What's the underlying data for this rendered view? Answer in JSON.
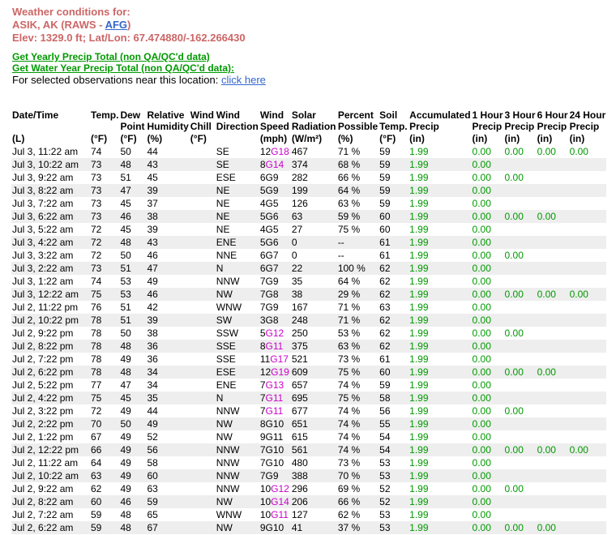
{
  "header": {
    "line1": "Weather conditions for:",
    "station_prefix": "ASIK, AK (RAWS - ",
    "station_link": "AFG",
    "station_suffix": ")",
    "elev": "Elev: 1329.0 ft; Lat/Lon: 67.474880/-162.266430"
  },
  "links": {
    "yearly": "Get Yearly Precip Total (non QA/QC'd data)",
    "water_year": "Get Water Year Precip Total (non QA/QC'd data):",
    "selected_text": "For selected observations near this location: ",
    "click_here": "click here"
  },
  "table": {
    "columns": [
      {
        "l1": "Date/Time",
        "l2": "",
        "l3": "(L)"
      },
      {
        "l1": "Temp.",
        "l2": "",
        "l3": "(°F)"
      },
      {
        "l1": "Dew",
        "l2": "Point",
        "l3": "(°F)"
      },
      {
        "l1": "Relative",
        "l2": "Humidity",
        "l3": "(%)"
      },
      {
        "l1": "Wind",
        "l2": "Chill",
        "l3": "(°F)"
      },
      {
        "l1": "Wind",
        "l2": "Direction",
        "l3": ""
      },
      {
        "l1": "Wind",
        "l2": "Speed",
        "l3": "(mph)"
      },
      {
        "l1": "Solar",
        "l2": "Radiation",
        "l3": "(W/m²)"
      },
      {
        "l1": "Percent",
        "l2": "Possible",
        "l3": "(%)"
      },
      {
        "l1": "Soil",
        "l2": "Temp.",
        "l3": "(°F)"
      },
      {
        "l1": "Accumulated",
        "l2": "Precip",
        "l3": "(in)"
      },
      {
        "l1": "1 Hour",
        "l2": "Precip",
        "l3": "(in)"
      },
      {
        "l1": "3 Hour",
        "l2": "Precip",
        "l3": "(in)"
      },
      {
        "l1": "6 Hour",
        "l2": "Precip",
        "l3": "(in)"
      },
      {
        "l1": "24 Hour",
        "l2": "Precip",
        "l3": "(in)"
      }
    ],
    "rows": [
      {
        "dt": "Jul 3, 11:22 am",
        "t": "74",
        "dp": "50",
        "rh": "44",
        "wc": "",
        "dir": "SE",
        "ws": "12",
        "wg": "G18",
        "sr": "467",
        "pp": "71 %",
        "st": "59",
        "acc": "1.99",
        "h1": "0.00",
        "h3": "0.00",
        "h6": "0.00",
        "h24": "0.00"
      },
      {
        "dt": "Jul 3, 10:22 am",
        "t": "73",
        "dp": "48",
        "rh": "43",
        "wc": "",
        "dir": "SE",
        "ws": "8",
        "wg": "G14",
        "sr": "374",
        "pp": "68 %",
        "st": "59",
        "acc": "1.99",
        "h1": "0.00",
        "h3": "",
        "h6": "",
        "h24": ""
      },
      {
        "dt": "Jul 3, 9:22 am",
        "t": "73",
        "dp": "51",
        "rh": "45",
        "wc": "",
        "dir": "ESE",
        "ws": "6G9",
        "wg": "",
        "sr": "282",
        "pp": "66 %",
        "st": "59",
        "acc": "1.99",
        "h1": "0.00",
        "h3": "0.00",
        "h6": "",
        "h24": ""
      },
      {
        "dt": "Jul 3, 8:22 am",
        "t": "73",
        "dp": "47",
        "rh": "39",
        "wc": "",
        "dir": "NE",
        "ws": "5G9",
        "wg": "",
        "sr": "199",
        "pp": "64 %",
        "st": "59",
        "acc": "1.99",
        "h1": "0.00",
        "h3": "",
        "h6": "",
        "h24": ""
      },
      {
        "dt": "Jul 3, 7:22 am",
        "t": "73",
        "dp": "45",
        "rh": "37",
        "wc": "",
        "dir": "NE",
        "ws": "4G5",
        "wg": "",
        "sr": "126",
        "pp": "63 %",
        "st": "59",
        "acc": "1.99",
        "h1": "0.00",
        "h3": "",
        "h6": "",
        "h24": ""
      },
      {
        "dt": "Jul 3, 6:22 am",
        "t": "73",
        "dp": "46",
        "rh": "38",
        "wc": "",
        "dir": "NE",
        "ws": "5G6",
        "wg": "",
        "sr": "63",
        "pp": "59 %",
        "st": "60",
        "acc": "1.99",
        "h1": "0.00",
        "h3": "0.00",
        "h6": "0.00",
        "h24": ""
      },
      {
        "dt": "Jul 3, 5:22 am",
        "t": "72",
        "dp": "45",
        "rh": "39",
        "wc": "",
        "dir": "NE",
        "ws": "4G5",
        "wg": "",
        "sr": "27",
        "pp": "75 %",
        "st": "60",
        "acc": "1.99",
        "h1": "0.00",
        "h3": "",
        "h6": "",
        "h24": ""
      },
      {
        "dt": "Jul 3, 4:22 am",
        "t": "72",
        "dp": "48",
        "rh": "43",
        "wc": "",
        "dir": "ENE",
        "ws": "5G6",
        "wg": "",
        "sr": "0",
        "pp": "--",
        "st": "61",
        "acc": "1.99",
        "h1": "0.00",
        "h3": "",
        "h6": "",
        "h24": ""
      },
      {
        "dt": "Jul 3, 3:22 am",
        "t": "72",
        "dp": "50",
        "rh": "46",
        "wc": "",
        "dir": "NNE",
        "ws": "6G7",
        "wg": "",
        "sr": "0",
        "pp": "--",
        "st": "61",
        "acc": "1.99",
        "h1": "0.00",
        "h3": "0.00",
        "h6": "",
        "h24": ""
      },
      {
        "dt": "Jul 3, 2:22 am",
        "t": "73",
        "dp": "51",
        "rh": "47",
        "wc": "",
        "dir": "N",
        "ws": "6G7",
        "wg": "",
        "sr": "22",
        "pp": "100 %",
        "st": "62",
        "acc": "1.99",
        "h1": "0.00",
        "h3": "",
        "h6": "",
        "h24": ""
      },
      {
        "dt": "Jul 3, 1:22 am",
        "t": "74",
        "dp": "53",
        "rh": "49",
        "wc": "",
        "dir": "NNW",
        "ws": "7G9",
        "wg": "",
        "sr": "35",
        "pp": "64 %",
        "st": "62",
        "acc": "1.99",
        "h1": "0.00",
        "h3": "",
        "h6": "",
        "h24": ""
      },
      {
        "dt": "Jul 3, 12:22 am",
        "t": "75",
        "dp": "53",
        "rh": "46",
        "wc": "",
        "dir": "NW",
        "ws": "7G8",
        "wg": "",
        "sr": "38",
        "pp": "29 %",
        "st": "62",
        "acc": "1.99",
        "h1": "0.00",
        "h3": "0.00",
        "h6": "0.00",
        "h24": "0.00"
      },
      {
        "dt": "Jul 2, 11:22 pm",
        "t": "76",
        "dp": "51",
        "rh": "42",
        "wc": "",
        "dir": "WNW",
        "ws": "7G9",
        "wg": "",
        "sr": "167",
        "pp": "71 %",
        "st": "63",
        "acc": "1.99",
        "h1": "0.00",
        "h3": "",
        "h6": "",
        "h24": ""
      },
      {
        "dt": "Jul 2, 10:22 pm",
        "t": "78",
        "dp": "51",
        "rh": "39",
        "wc": "",
        "dir": "SW",
        "ws": "3G8",
        "wg": "",
        "sr": "248",
        "pp": "71 %",
        "st": "62",
        "acc": "1.99",
        "h1": "0.00",
        "h3": "",
        "h6": "",
        "h24": ""
      },
      {
        "dt": "Jul 2, 9:22 pm",
        "t": "78",
        "dp": "50",
        "rh": "38",
        "wc": "",
        "dir": "SSW",
        "ws": "5",
        "wg": "G12",
        "sr": "250",
        "pp": "53 %",
        "st": "62",
        "acc": "1.99",
        "h1": "0.00",
        "h3": "0.00",
        "h6": "",
        "h24": ""
      },
      {
        "dt": "Jul 2, 8:22 pm",
        "t": "78",
        "dp": "48",
        "rh": "36",
        "wc": "",
        "dir": "SSE",
        "ws": "8",
        "wg": "G11",
        "sr": "375",
        "pp": "63 %",
        "st": "62",
        "acc": "1.99",
        "h1": "0.00",
        "h3": "",
        "h6": "",
        "h24": ""
      },
      {
        "dt": "Jul 2, 7:22 pm",
        "t": "78",
        "dp": "49",
        "rh": "36",
        "wc": "",
        "dir": "SSE",
        "ws": "11",
        "wg": "G17",
        "sr": "521",
        "pp": "73 %",
        "st": "61",
        "acc": "1.99",
        "h1": "0.00",
        "h3": "",
        "h6": "",
        "h24": ""
      },
      {
        "dt": "Jul 2, 6:22 pm",
        "t": "78",
        "dp": "48",
        "rh": "34",
        "wc": "",
        "dir": "ESE",
        "ws": "12",
        "wg": "G19",
        "sr": "609",
        "pp": "75 %",
        "st": "60",
        "acc": "1.99",
        "h1": "0.00",
        "h3": "0.00",
        "h6": "0.00",
        "h24": ""
      },
      {
        "dt": "Jul 2, 5:22 pm",
        "t": "77",
        "dp": "47",
        "rh": "34",
        "wc": "",
        "dir": "ENE",
        "ws": "7",
        "wg": "G13",
        "sr": "657",
        "pp": "74 %",
        "st": "59",
        "acc": "1.99",
        "h1": "0.00",
        "h3": "",
        "h6": "",
        "h24": ""
      },
      {
        "dt": "Jul 2, 4:22 pm",
        "t": "75",
        "dp": "45",
        "rh": "35",
        "wc": "",
        "dir": "N",
        "ws": "7",
        "wg": "G11",
        "sr": "695",
        "pp": "75 %",
        "st": "58",
        "acc": "1.99",
        "h1": "0.00",
        "h3": "",
        "h6": "",
        "h24": ""
      },
      {
        "dt": "Jul 2, 3:22 pm",
        "t": "72",
        "dp": "49",
        "rh": "44",
        "wc": "",
        "dir": "NNW",
        "ws": "7",
        "wg": "G11",
        "sr": "677",
        "pp": "74 %",
        "st": "56",
        "acc": "1.99",
        "h1": "0.00",
        "h3": "0.00",
        "h6": "",
        "h24": ""
      },
      {
        "dt": "Jul 2, 2:22 pm",
        "t": "70",
        "dp": "50",
        "rh": "49",
        "wc": "",
        "dir": "NW",
        "ws": "8G10",
        "wg": "",
        "sr": "651",
        "pp": "74 %",
        "st": "55",
        "acc": "1.99",
        "h1": "0.00",
        "h3": "",
        "h6": "",
        "h24": ""
      },
      {
        "dt": "Jul 2, 1:22 pm",
        "t": "67",
        "dp": "49",
        "rh": "52",
        "wc": "",
        "dir": "NW",
        "ws": "9G11",
        "wg": "",
        "sr": "615",
        "pp": "74 %",
        "st": "54",
        "acc": "1.99",
        "h1": "0.00",
        "h3": "",
        "h6": "",
        "h24": ""
      },
      {
        "dt": "Jul 2, 12:22 pm",
        "t": "66",
        "dp": "49",
        "rh": "56",
        "wc": "",
        "dir": "NNW",
        "ws": "7G10",
        "wg": "",
        "sr": "561",
        "pp": "74 %",
        "st": "54",
        "acc": "1.99",
        "h1": "0.00",
        "h3": "0.00",
        "h6": "0.00",
        "h24": "0.00"
      },
      {
        "dt": "Jul 2, 11:22 am",
        "t": "64",
        "dp": "49",
        "rh": "58",
        "wc": "",
        "dir": "NNW",
        "ws": "7G10",
        "wg": "",
        "sr": "480",
        "pp": "73 %",
        "st": "53",
        "acc": "1.99",
        "h1": "0.00",
        "h3": "",
        "h6": "",
        "h24": ""
      },
      {
        "dt": "Jul 2, 10:22 am",
        "t": "63",
        "dp": "49",
        "rh": "60",
        "wc": "",
        "dir": "NNW",
        "ws": "7G9",
        "wg": "",
        "sr": "388",
        "pp": "70 %",
        "st": "53",
        "acc": "1.99",
        "h1": "0.00",
        "h3": "",
        "h6": "",
        "h24": ""
      },
      {
        "dt": "Jul 2, 9:22 am",
        "t": "62",
        "dp": "49",
        "rh": "63",
        "wc": "",
        "dir": "NNW",
        "ws": "10",
        "wg": "G12",
        "sr": "296",
        "pp": "69 %",
        "st": "52",
        "acc": "1.99",
        "h1": "0.00",
        "h3": "0.00",
        "h6": "",
        "h24": ""
      },
      {
        "dt": "Jul 2, 8:22 am",
        "t": "60",
        "dp": "46",
        "rh": "59",
        "wc": "",
        "dir": "NW",
        "ws": "10",
        "wg": "G14",
        "sr": "206",
        "pp": "66 %",
        "st": "52",
        "acc": "1.99",
        "h1": "0.00",
        "h3": "",
        "h6": "",
        "h24": ""
      },
      {
        "dt": "Jul 2, 7:22 am",
        "t": "59",
        "dp": "48",
        "rh": "65",
        "wc": "",
        "dir": "WNW",
        "ws": "10",
        "wg": "G11",
        "sr": "127",
        "pp": "62 %",
        "st": "53",
        "acc": "1.99",
        "h1": "0.00",
        "h3": "",
        "h6": "",
        "h24": ""
      },
      {
        "dt": "Jul 2, 6:22 am",
        "t": "59",
        "dp": "48",
        "rh": "67",
        "wc": "",
        "dir": "NW",
        "ws": "9G10",
        "wg": "",
        "sr": "41",
        "pp": "37 %",
        "st": "53",
        "acc": "1.99",
        "h1": "0.00",
        "h3": "0.00",
        "h6": "0.00",
        "h24": ""
      }
    ]
  },
  "colors": {
    "header_text": "#cc6666",
    "link_blue": "#3366cc",
    "green_link": "#009900",
    "precip_green": "#009900",
    "gust_magenta": "#cc00cc",
    "row_alt_bg": "#eeeeee"
  }
}
